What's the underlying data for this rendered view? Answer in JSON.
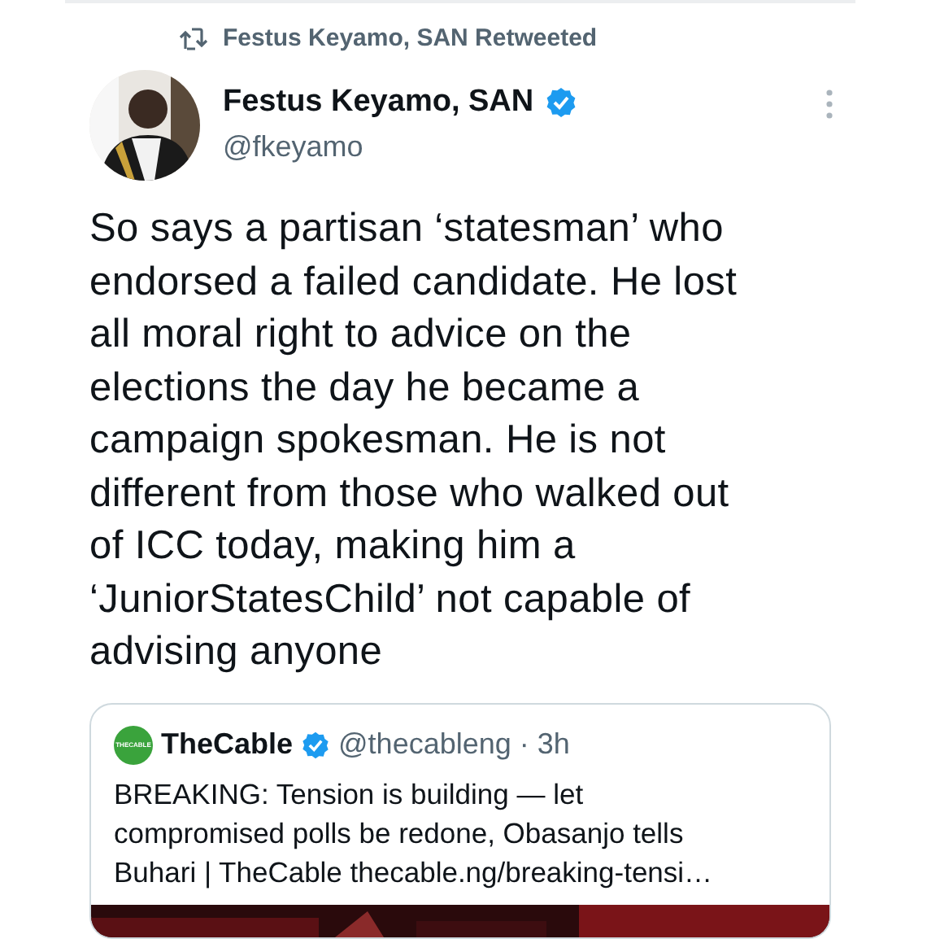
{
  "retweet_note": "Festus Keyamo, SAN Retweeted",
  "author": {
    "name": "Festus Keyamo, SAN",
    "verified": true,
    "handle": "@fkeyamo"
  },
  "text": "So says a partisan ‘statesman’ who endorsed a failed candidate. He lost all moral right to advice on the elections the day he became a campaign spokesman. He is not different from those who walked out of ICC today, making him a ‘JuniorStatesChild’ not capable of advising anyone",
  "quoted_tweet": {
    "logo": "THECABLE",
    "name": "TheCable",
    "verified": true,
    "handle": "@thecableng",
    "time": "· 3h",
    "text": "BREAKING: Tension is building — let compromised polls be redone, Obasanjo tells Buhari | TheCable thecable.ng/breaking-tensi…"
  }
}
